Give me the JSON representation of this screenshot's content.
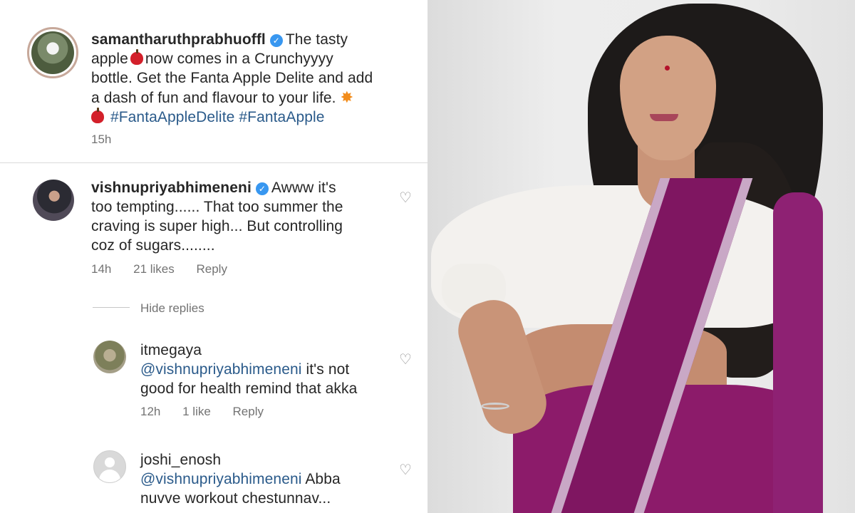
{
  "post": {
    "username": "samantharuthprabhuoffl",
    "verified_mark": "✓",
    "text_line1": "The tasty",
    "text_line2_a": "apple",
    "text_line2_b": "now comes in a Crunchyyyy",
    "text_line3": "bottle.  Get the Fanta Apple Delite and add",
    "text_line4": "a dash of fun and flavour to your life.",
    "hashtag1": "#FantaAppleDelite",
    "hashtag2": "#FantaApple",
    "time": "15h"
  },
  "comments": [
    {
      "username": "vishnupriyabhimeneni",
      "verified_mark": "✓",
      "line1": "Awww it's",
      "line2": "too tempting...... That too summer the",
      "line3": "craving is super high... But controlling",
      "line4": "coz of sugars........",
      "time": "14h",
      "likes": "21 likes",
      "reply": "Reply",
      "hide_replies": "Hide replies"
    },
    {
      "username": "itmegaya",
      "mention": "@vishnupriyabhimeneni",
      "line1_rest": "it's not",
      "line2": "good for health remind that akka",
      "time": "12h",
      "likes": "1 like",
      "reply": "Reply"
    },
    {
      "username": "joshi_enosh",
      "mention": "@vishnupriyabhimeneni",
      "line1_rest": "Abba",
      "line2": "nuvve workout chestunnav..."
    }
  ],
  "icons": {
    "heart": "♡",
    "burst": "✸"
  },
  "colors": {
    "verified_blue": "#3897f0",
    "hashtag": "#2a5a8a",
    "saree": "#8c1b6a"
  }
}
